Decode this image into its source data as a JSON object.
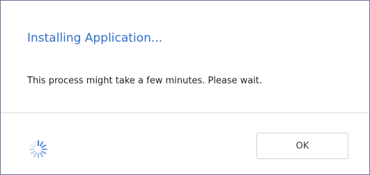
{
  "dialog": {
    "title": "Installing Application...",
    "message": "This process might take a few minutes. Please wait.",
    "ok_label": "OK",
    "spinner_icon": "loading-spinner-icon"
  },
  "colors": {
    "title": "#2f6fc8",
    "spinner": "#4a86d8",
    "border": "#6b6f9a"
  }
}
